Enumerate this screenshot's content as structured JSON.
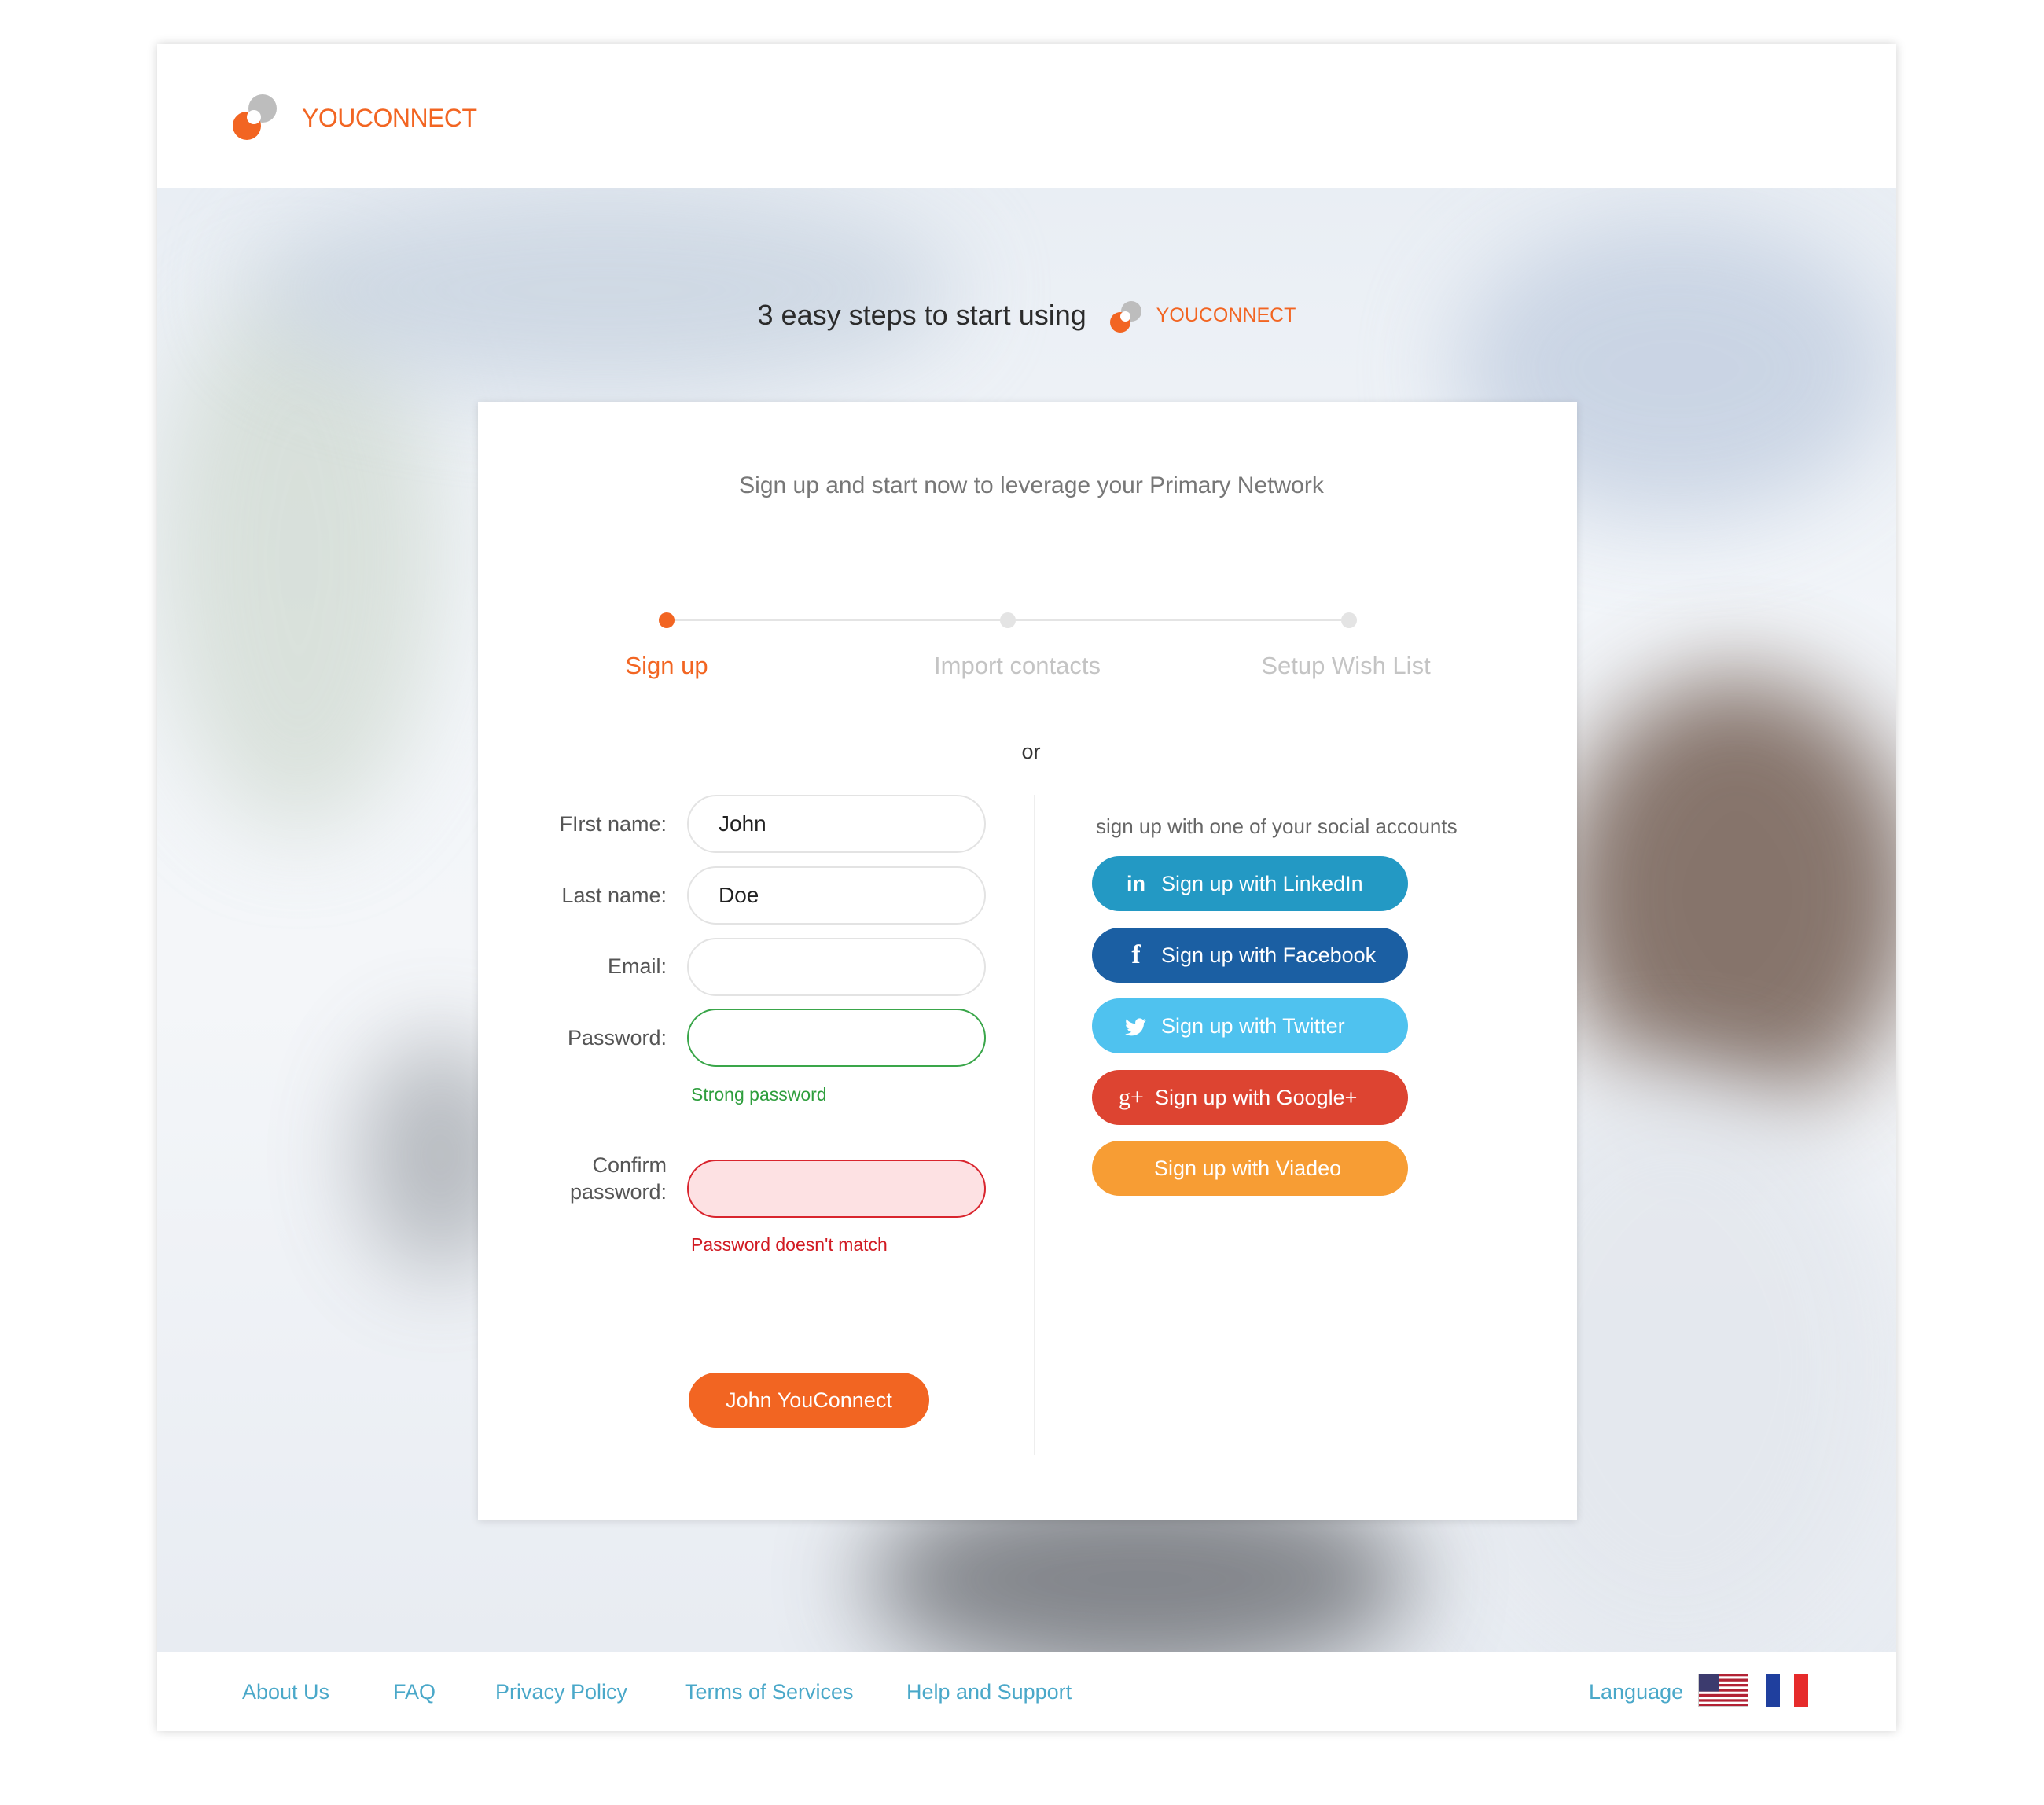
{
  "brand": {
    "name": "YOUCONNECT"
  },
  "hero": {
    "steps_title": "3 easy steps to start using"
  },
  "card": {
    "subtitle": "Sign up and start now to leverage your Primary Network",
    "steps": [
      {
        "label": "Sign up",
        "active": true
      },
      {
        "label": "Import contacts",
        "active": false
      },
      {
        "label": "Setup Wish List",
        "active": false
      }
    ],
    "or_label": "or"
  },
  "form": {
    "first_name": {
      "label": "FIrst name:",
      "value": "John"
    },
    "last_name": {
      "label": "Last name:",
      "value": "Doe"
    },
    "email": {
      "label": "Email:",
      "value": ""
    },
    "password": {
      "label": "Password:",
      "value": "",
      "hint": "Strong password"
    },
    "confirm_password": {
      "label_line1": "Confirm",
      "label_line2": "password:",
      "value": "",
      "hint": "Password doesn't match"
    },
    "submit_label": "John YouConnect"
  },
  "social": {
    "title": "sign up with one of your social accounts",
    "buttons": [
      {
        "label": "Sign up with LinkedIn",
        "icon": "linkedin-icon",
        "color": "#2399c4"
      },
      {
        "label": "Sign up with Facebook",
        "icon": "facebook-icon",
        "color": "#1b5fa3"
      },
      {
        "label": "Sign up with Twitter",
        "icon": "twitter-icon",
        "color": "#4fc2ef"
      },
      {
        "label": "Sign up with Google+",
        "icon": "google-plus-icon",
        "color": "#dd4431"
      },
      {
        "label": "Sign up with Viadeo",
        "icon": "",
        "color": "#f79d34"
      }
    ]
  },
  "footer": {
    "links": [
      "About Us",
      "FAQ",
      "Privacy Policy",
      "Terms of Services",
      "Help and Support"
    ],
    "language_label": "Language",
    "flags": [
      "us-flag-icon",
      "france-flag-icon"
    ]
  },
  "colors": {
    "accent": "#f26522",
    "link": "#4aa8c9",
    "success": "#2e9e3d",
    "error": "#d11a22"
  }
}
